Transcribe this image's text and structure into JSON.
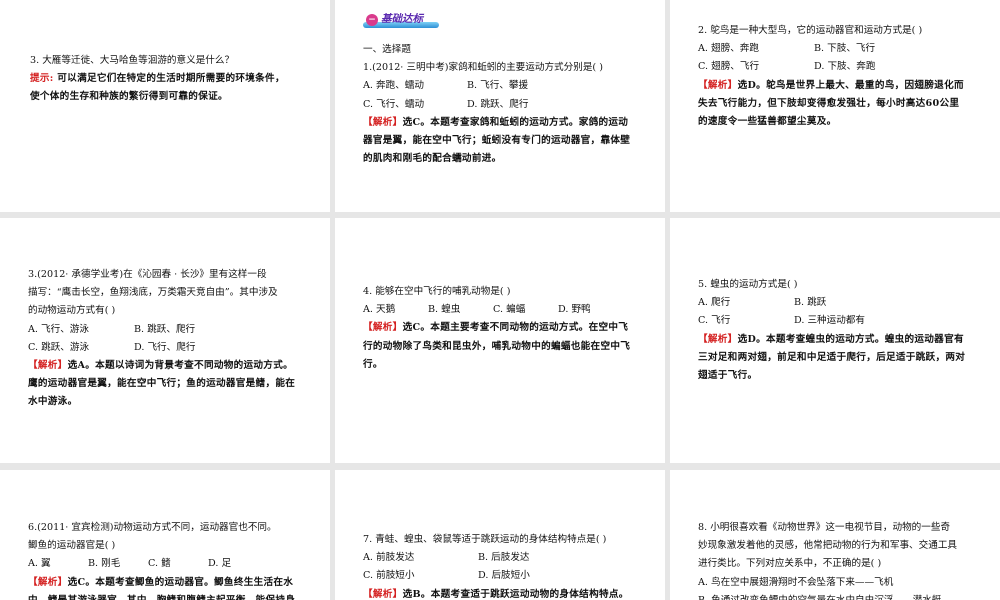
{
  "colors": {
    "label": "#d42020",
    "badge_text": "#5b2bb0",
    "badge_bar": "#2d8fd5"
  },
  "panels": [
    {
      "lines": [
        {
          "type": "text",
          "text": "3. 大雁等迁徙、大马哈鱼等洄游的意义是什么？"
        },
        {
          "type": "explain",
          "label": "提示:",
          "text": " 可以满足它们在特定的生活时期所需要的环境条件，"
        },
        {
          "type": "explain",
          "text": "使个体的生存和种族的繁衍得到可靠的保证。"
        }
      ]
    },
    {
      "badge": {
        "icon": "minus-circle-icon",
        "text": "基础达标"
      },
      "lines": [
        {
          "type": "text",
          "text": "一、选择题"
        },
        {
          "type": "text",
          "text": "1.(2012· 三明中考)家鸽和蚯蚓的主要运动方式分别是(    )"
        },
        {
          "type": "options",
          "items": [
            "A. 奔跑、蠕动",
            "B. 飞行、攀援"
          ]
        },
        {
          "type": "options",
          "items": [
            "C. 飞行、蠕动",
            "D. 跳跃、爬行"
          ]
        },
        {
          "type": "explain",
          "label": "【解析】",
          "text": "选C。本题考查家鸽和蚯蚓的运动方式。家鸽的运动"
        },
        {
          "type": "explain",
          "text": "器官是翼，能在空中飞行；蚯蚓没有专门的运动器官，靠体壁"
        },
        {
          "type": "explain",
          "text": "的肌肉和刚毛的配合蠕动前进。"
        }
      ]
    },
    {
      "lines": [
        {
          "type": "text",
          "text": "2. 鸵鸟是一种大型鸟，它的运动器官和运动方式是(    )"
        },
        {
          "type": "options",
          "items": [
            "A. 翅膀、奔跑",
            "B. 下肢、飞行"
          ]
        },
        {
          "type": "options",
          "items": [
            "C. 翅膀、飞行",
            "D. 下肢、奔跑"
          ]
        },
        {
          "type": "explain",
          "label": "【解析】",
          "text": "选D。鸵鸟是世界上最大、最重的鸟，因翅膀退化而"
        },
        {
          "type": "explain",
          "text": "失去飞行能力，但下肢却变得愈发强壮，每小时高达60公里"
        },
        {
          "type": "explain",
          "text": "的速度令一些猛兽都望尘莫及。"
        }
      ]
    },
    {
      "lines": [
        {
          "type": "text",
          "text": "3.(2012· 承德学业考)在《沁园春 · 长沙》里有这样一段"
        },
        {
          "type": "text",
          "text": "描写：“鹰击长空，鱼翔浅底，万类霜天竞自由”。其中涉及"
        },
        {
          "type": "text",
          "text": "的动物运动方式有(    )"
        },
        {
          "type": "options",
          "items": [
            "A. 飞行、游泳",
            "B. 跳跃、爬行"
          ]
        },
        {
          "type": "options",
          "items": [
            "C. 跳跃、游泳",
            "D. 飞行、爬行"
          ]
        },
        {
          "type": "explain",
          "label": "【解析】",
          "text": "选A。本题以诗词为背景考查不同动物的运动方式。"
        },
        {
          "type": "explain",
          "text": "鹰的运动器官是翼，能在空中飞行；鱼的运动器官是鳍，能在"
        },
        {
          "type": "explain",
          "text": "水中游泳。"
        }
      ]
    },
    {
      "lines": [
        {
          "type": "text",
          "text": "4. 能够在空中飞行的哺乳动物是(    )"
        },
        {
          "type": "options",
          "items": [
            "A. 天鹅",
            "B. 蝗虫",
            "C. 蝙蝠",
            "D. 野鸭"
          ]
        },
        {
          "type": "explain",
          "label": "【解析】",
          "text": "选C。本题主要考查不同动物的运动方式。在空中飞"
        },
        {
          "type": "explain",
          "text": "行的动物除了鸟类和昆虫外，哺乳动物中的蝙蝠也能在空中飞"
        },
        {
          "type": "explain",
          "text": "行。"
        }
      ]
    },
    {
      "lines": [
        {
          "type": "text",
          "text": "5. 蝗虫的运动方式是(    )"
        },
        {
          "type": "options",
          "items": [
            "A. 爬行",
            "B. 跳跃"
          ]
        },
        {
          "type": "options",
          "items": [
            "C. 飞行",
            "D. 三种运动都有"
          ]
        },
        {
          "type": "explain",
          "label": "【解析】",
          "text": "选D。本题考查蝗虫的运动方式。蝗虫的运动器官有"
        },
        {
          "type": "explain",
          "text": "三对足和两对翅，前足和中足适于爬行，后足适于跳跃，两对"
        },
        {
          "type": "explain",
          "text": "翅适于飞行。"
        }
      ]
    },
    {
      "lines": [
        {
          "type": "text",
          "text": "6.(2011· 宜宾检测)动物运动方式不同，运动器官也不同。"
        },
        {
          "type": "text",
          "text": "鲫鱼的运动器官是(    )"
        },
        {
          "type": "options",
          "items": [
            "A. 翼",
            "B. 刚毛",
            "C. 鳍",
            "D. 足"
          ]
        },
        {
          "type": "explain",
          "label": "【解析】",
          "text": "选C。本题考查鲫鱼的运动器官。鲫鱼终生生活在水"
        },
        {
          "type": "explain",
          "text": "中，鳍是其游泳器官。其中，胸鳍和腹鳍主起平衡，能保持身"
        }
      ]
    },
    {
      "lines": [
        {
          "type": "text",
          "text": "7. 青蛙、蝗虫、袋鼠等适于跳跃运动的身体结构特点是(    )"
        },
        {
          "type": "options",
          "items": [
            "A. 前肢发达",
            "B. 后肢发达"
          ]
        },
        {
          "type": "options",
          "items": [
            "C. 前肢短小",
            "D. 后肢短小"
          ]
        },
        {
          "type": "explain",
          "label": "【解析】",
          "text": "选B。本题考查适于跳跃运动动物的身体结构特点。"
        }
      ]
    },
    {
      "lines": [
        {
          "type": "text",
          "text": "8. 小明很喜欢看《动物世界》这一电视节目，动物的一些奇"
        },
        {
          "type": "text",
          "text": "妙现象激发着他的灵感，他常把动物的行为和军事、交通工具"
        },
        {
          "type": "text",
          "text": "进行类比。下列对应关系中，不正确的是(    )"
        },
        {
          "type": "text",
          "text": "A. 鸟在空中展翅滑翔时不会坠落下来——飞机"
        },
        {
          "type": "text",
          "text": "B. 鱼通过改变鱼鳔中的空气量在水中自由沉浮——潜水艇"
        }
      ]
    }
  ]
}
